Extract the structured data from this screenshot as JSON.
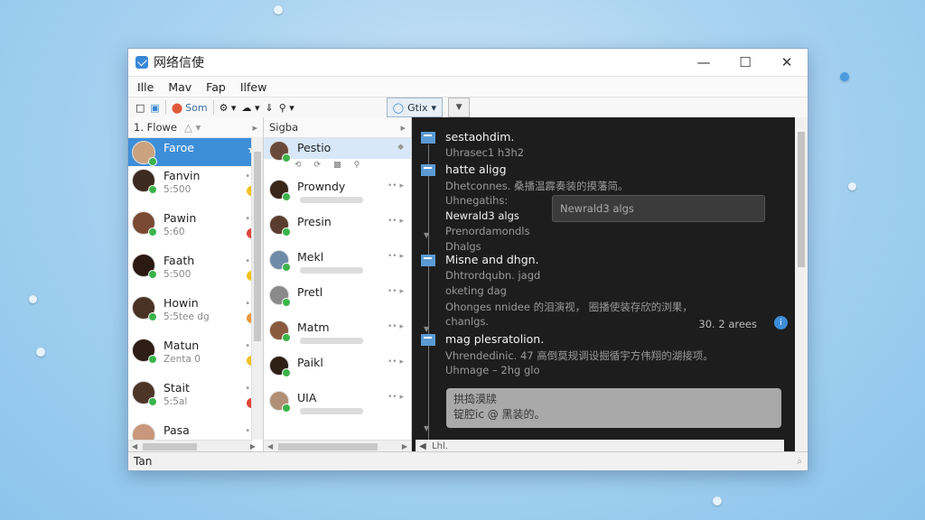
{
  "window": {
    "title": "网络信使"
  },
  "menu": [
    "Ille",
    "Mav",
    "Fap",
    "Ilfew"
  ],
  "toolbar": {
    "button_label": "Som",
    "context_tab": "Gtix"
  },
  "contacts_panel": {
    "header": "1. Flowe",
    "items": [
      {
        "name": "Faroe",
        "sub": "",
        "selected": true,
        "badge_color": "",
        "avatar_color": "#caa27f"
      },
      {
        "name": "Fanvin",
        "sub": "5:500",
        "selected": false,
        "badge_color": "#f2c21b",
        "avatar_color": "#3c2a20"
      },
      {
        "name": "Pawin",
        "sub": "5:60",
        "selected": false,
        "badge_color": "#e0463a",
        "avatar_color": "#7a4a32"
      },
      {
        "name": "Faath",
        "sub": "5:500",
        "selected": false,
        "badge_color": "#f2c21b",
        "avatar_color": "#2a1a12"
      },
      {
        "name": "Howin",
        "sub": "5:5tee dg",
        "selected": false,
        "badge_color": "#f0953a",
        "avatar_color": "#4a3324"
      },
      {
        "name": "Matun",
        "sub": "Zenta 0",
        "selected": false,
        "badge_color": "#f2c21b",
        "avatar_color": "#2e1d14"
      },
      {
        "name": "Stait",
        "sub": "5:5al",
        "selected": false,
        "badge_color": "#e0463a",
        "avatar_color": "#4d3526"
      },
      {
        "name": "Pasa",
        "sub": "",
        "selected": false,
        "badge_color": "",
        "avatar_color": "#c9977a"
      }
    ]
  },
  "conversations_panel": {
    "header": "Sigba",
    "items": [
      {
        "name": "Pestio",
        "selected": true,
        "avatar_color": "#6a4a3a"
      },
      {
        "name": "Prowndy",
        "selected": false,
        "avatar_color": "#3a2619"
      },
      {
        "name": "Presin",
        "selected": false,
        "avatar_color": "#5a3d2e"
      },
      {
        "name": "Mekl",
        "selected": false,
        "avatar_color": "#6d8aa8"
      },
      {
        "name": "Pretl",
        "selected": false,
        "avatar_color": "#8a8a8a"
      },
      {
        "name": "Matm",
        "selected": false,
        "avatar_color": "#8a5a3e"
      },
      {
        "name": "Paikl",
        "selected": false,
        "avatar_color": "#2f2016"
      },
      {
        "name": "UIA",
        "selected": false,
        "avatar_color": "#b08f74"
      }
    ]
  },
  "messages": [
    {
      "title": "sestaohdim.",
      "lines": [
        "Uhrasec1 h3h2"
      ]
    },
    {
      "title": "hatte aligg",
      "lines": [
        "Dhetconnes. 桑播温霹奏装的摸藩简。",
        "Uhnegatihs:",
        "Newrald3 algs",
        "Prenordamondls",
        "Dhalgs"
      ]
    },
    {
      "title": "Misne and dhgn.",
      "lines": [
        "Dhtrordqubn. jagd",
        "oketing dag",
        "Ohonges nnidee 的泪演视， 圈播使装存欣的浏果，",
        "chanlgs."
      ]
    },
    {
      "title": "mag plesratolion.",
      "lines": [
        "Vhrendedinic. 47 高倒莫规调设掘循宇方伟翔的湖接项。",
        "Uhmage – 2hg glo"
      ]
    }
  ],
  "popup_text": "Newrald3 algs",
  "timestamp": "30. 2 arees",
  "reply": {
    "line1": "拱捣漠牍",
    "line2": "锭腔ic @ 黑装的。"
  },
  "col3_bottom_label": "Lhl.",
  "status": {
    "text": "Tan"
  }
}
